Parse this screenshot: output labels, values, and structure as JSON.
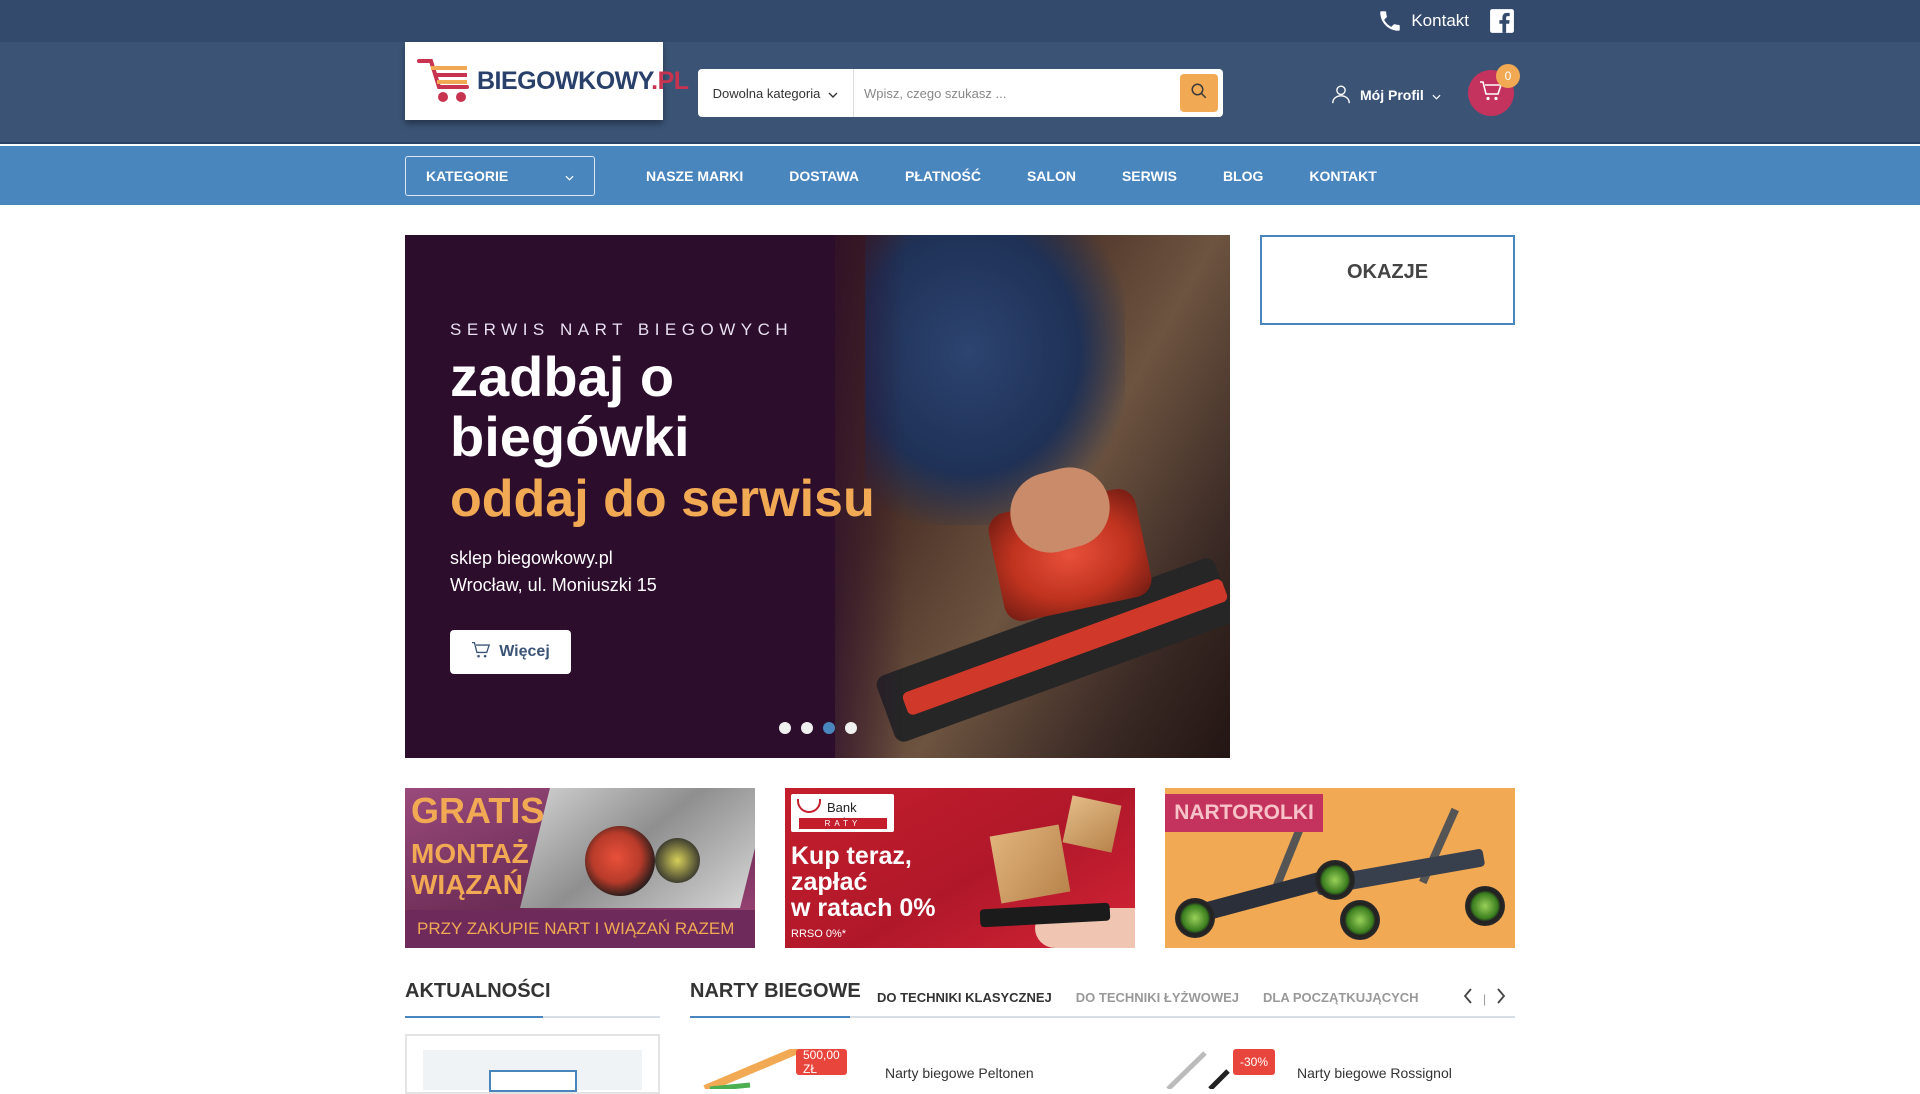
{
  "topbar": {
    "contact_label": "Kontakt"
  },
  "header": {
    "logo_text_main": "BIEGOWKOWY",
    "logo_text_dot": ".PL",
    "search": {
      "category": "Dowolna kategoria",
      "placeholder": "Wpisz, czego szukasz ..."
    },
    "profile_label": "Mój Profil",
    "cart_count": "0"
  },
  "nav": {
    "categories_label": "KATEGORIE",
    "items": [
      {
        "label": "NASZE MARKI"
      },
      {
        "label": "DOSTAWA"
      },
      {
        "label": "PŁATNOŚĆ"
      },
      {
        "label": "SALON"
      },
      {
        "label": "SERWIS"
      },
      {
        "label": "BLOG"
      },
      {
        "label": "KONTAKT"
      }
    ]
  },
  "hero": {
    "kicker": "SERWIS NART BIEGOWYCH",
    "headline": "zadbaj o biegówki",
    "subheadline": "oddaj do serwisu",
    "line1": "sklep biegowkowy.pl",
    "line2": "Wrocław, ul. Moniuszki 15",
    "button_label": "Więcej",
    "active_slide": 3,
    "slide_count": 4
  },
  "okazje": {
    "title": "OKAZJE"
  },
  "banners": {
    "b1": {
      "title": "GRATIS",
      "subtitle_l1": "MONTAŻ",
      "subtitle_l2": "WIĄZAŃ",
      "strip": "PRZY ZAKUPIE NART I WIĄZAŃ RAZEM"
    },
    "b2": {
      "bank_name": "Bank Pekao",
      "bank_sub": "RATY",
      "l1": "Kup teraz,",
      "l2": "zapłać",
      "l3": "w ratach 0%",
      "note": "RRSO 0%*"
    },
    "b3": {
      "label": "NARTOROLKI"
    }
  },
  "sections": {
    "news_title": "AKTUALNOŚCI",
    "skis_title": "NARTY BIEGOWE",
    "tabs": [
      {
        "label": "DO TECHNIKI KLASYCZNEJ"
      },
      {
        "label": "DO TECHNIKI ŁYŻWOWEJ"
      },
      {
        "label": "DLA POCZĄTKUJĄCYCH"
      }
    ]
  },
  "products": [
    {
      "tag": "500,00 ZŁ",
      "name": "Narty biegowe Peltonen"
    },
    {
      "tag": "-30%",
      "name": "Narty biegowe Rossignol"
    }
  ],
  "colors": {
    "topbar": "#334a6c",
    "header": "#3b5476",
    "nav": "#4a86be",
    "accent": "#f2a954",
    "cart": "#c4335d",
    "sale": "#e8463d"
  }
}
